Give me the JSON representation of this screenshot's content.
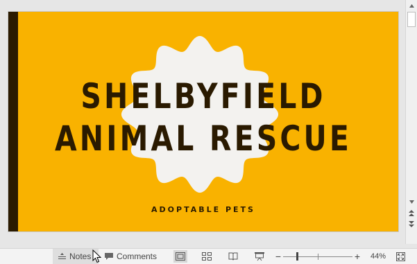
{
  "slide": {
    "title": "SHELBYFIELD\nANIMAL RESCUE",
    "subtitle": "ADOPTABLE PETS",
    "colors": {
      "background": "#f9b200",
      "accent_bar": "#2a1a00",
      "badge": "#f3f2ef",
      "text": "#2a1a00"
    }
  },
  "scrollbar": {
    "up_icon": "triangle-up-icon",
    "down_icon": "triangle-down-icon",
    "prev_slide_icon": "double-chevron-up-icon",
    "next_slide_icon": "double-chevron-down-icon"
  },
  "statusbar": {
    "notes_label": "Notes",
    "comments_label": "Comments",
    "zoom_out": "−",
    "zoom_in": "+",
    "zoom_percent": "44%",
    "zoom_level": 0.44,
    "views": [
      "normal-view-icon",
      "slide-sorter-icon",
      "reading-view-icon",
      "slide-show-icon"
    ],
    "fit_icon": "fit-to-window-icon"
  }
}
